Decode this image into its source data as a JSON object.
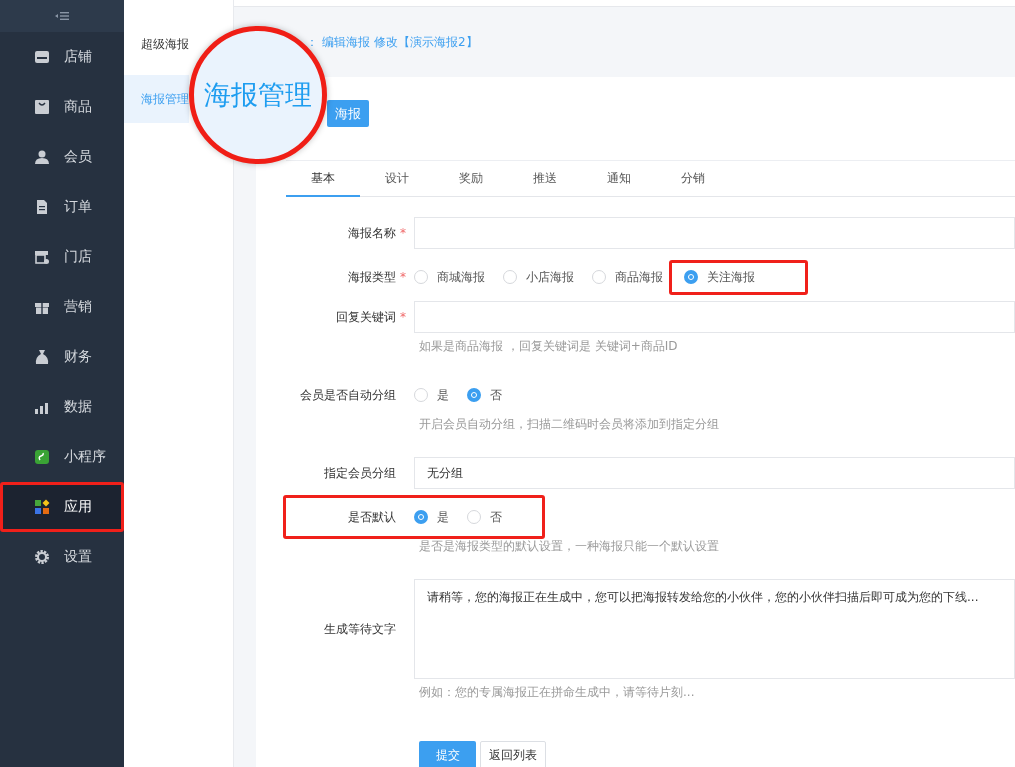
{
  "sidebar": {
    "items": [
      {
        "label": "店铺",
        "selected": false,
        "highlighted": false
      },
      {
        "label": "商品",
        "selected": false,
        "highlighted": false
      },
      {
        "label": "会员",
        "selected": false,
        "highlighted": false
      },
      {
        "label": "订单",
        "selected": false,
        "highlighted": false
      },
      {
        "label": "门店",
        "selected": false,
        "highlighted": false
      },
      {
        "label": "营销",
        "selected": false,
        "highlighted": false
      },
      {
        "label": "财务",
        "selected": false,
        "highlighted": false
      },
      {
        "label": "数据",
        "selected": false,
        "highlighted": false
      },
      {
        "label": "小程序",
        "selected": false,
        "highlighted": false
      },
      {
        "label": "应用",
        "selected": true,
        "highlighted": true
      },
      {
        "label": "设置",
        "selected": false,
        "highlighted": false
      }
    ]
  },
  "subnav": {
    "items": [
      {
        "label": "超级海报",
        "selected": false
      },
      {
        "label": "海报管理",
        "selected": true
      }
    ]
  },
  "breadcrumb": {
    "prefix": "：",
    "links": [
      "编辑海报",
      "修改【演示海报2】"
    ]
  },
  "add_button": "海报",
  "callout": {
    "text": "海报管理"
  },
  "tabs": [
    {
      "label": "基本",
      "selected": true
    },
    {
      "label": "设计",
      "selected": false
    },
    {
      "label": "奖励",
      "selected": false
    },
    {
      "label": "推送",
      "selected": false
    },
    {
      "label": "通知",
      "selected": false
    },
    {
      "label": "分销",
      "selected": false
    }
  ],
  "form": {
    "fields": [
      {
        "kind": "input",
        "label": "海报名称",
        "required_mark": "*",
        "highlighted": false
      },
      {
        "kind": "radio",
        "label": "海报类型",
        "required_mark": "*",
        "highlighted": false,
        "options": [
          {
            "label": "商城海报",
            "selected": false,
            "highlighted": false
          },
          {
            "label": "小店海报",
            "selected": false,
            "highlighted": false
          },
          {
            "label": "商品海报",
            "selected": false,
            "highlighted": false
          },
          {
            "label": "关注海报",
            "selected": true,
            "highlighted": true
          }
        ]
      },
      {
        "kind": "input",
        "label": "回复关键词",
        "required_mark": "*",
        "highlighted": false,
        "hint": "如果是商品海报 ，回复关键词是 关键词+商品ID"
      },
      {
        "kind": "radio",
        "label": "会员是否自动分组",
        "highlighted": false,
        "options": [
          {
            "label": "是",
            "selected": false,
            "highlighted": false
          },
          {
            "label": "否",
            "selected": true,
            "highlighted": false
          }
        ],
        "hint": "开启会员自动分组，扫描二维码时会员将添加到指定分组"
      },
      {
        "kind": "select",
        "label": "指定会员分组",
        "highlighted": false,
        "value": "无分组"
      },
      {
        "kind": "radio",
        "label": "是否默认",
        "highlighted": true,
        "options": [
          {
            "label": "是",
            "selected": true,
            "highlighted": false
          },
          {
            "label": "否",
            "selected": false,
            "highlighted": false
          }
        ],
        "hint": "是否是海报类型的默认设置，一种海报只能一个默认设置"
      },
      {
        "kind": "textarea",
        "label": "生成等待文字",
        "highlighted": false,
        "value": "请稍等，您的海报正在生成中，您可以把海报转发给您的小伙伴，您的小伙伴扫描后即可成为您的下线...",
        "hint": "例如：您的专属海报正在拼命生成中，请等待片刻..."
      }
    ],
    "buttons": [
      {
        "label": "提交",
        "kind": "primary"
      },
      {
        "label": "返回列表",
        "kind": "default"
      }
    ]
  }
}
